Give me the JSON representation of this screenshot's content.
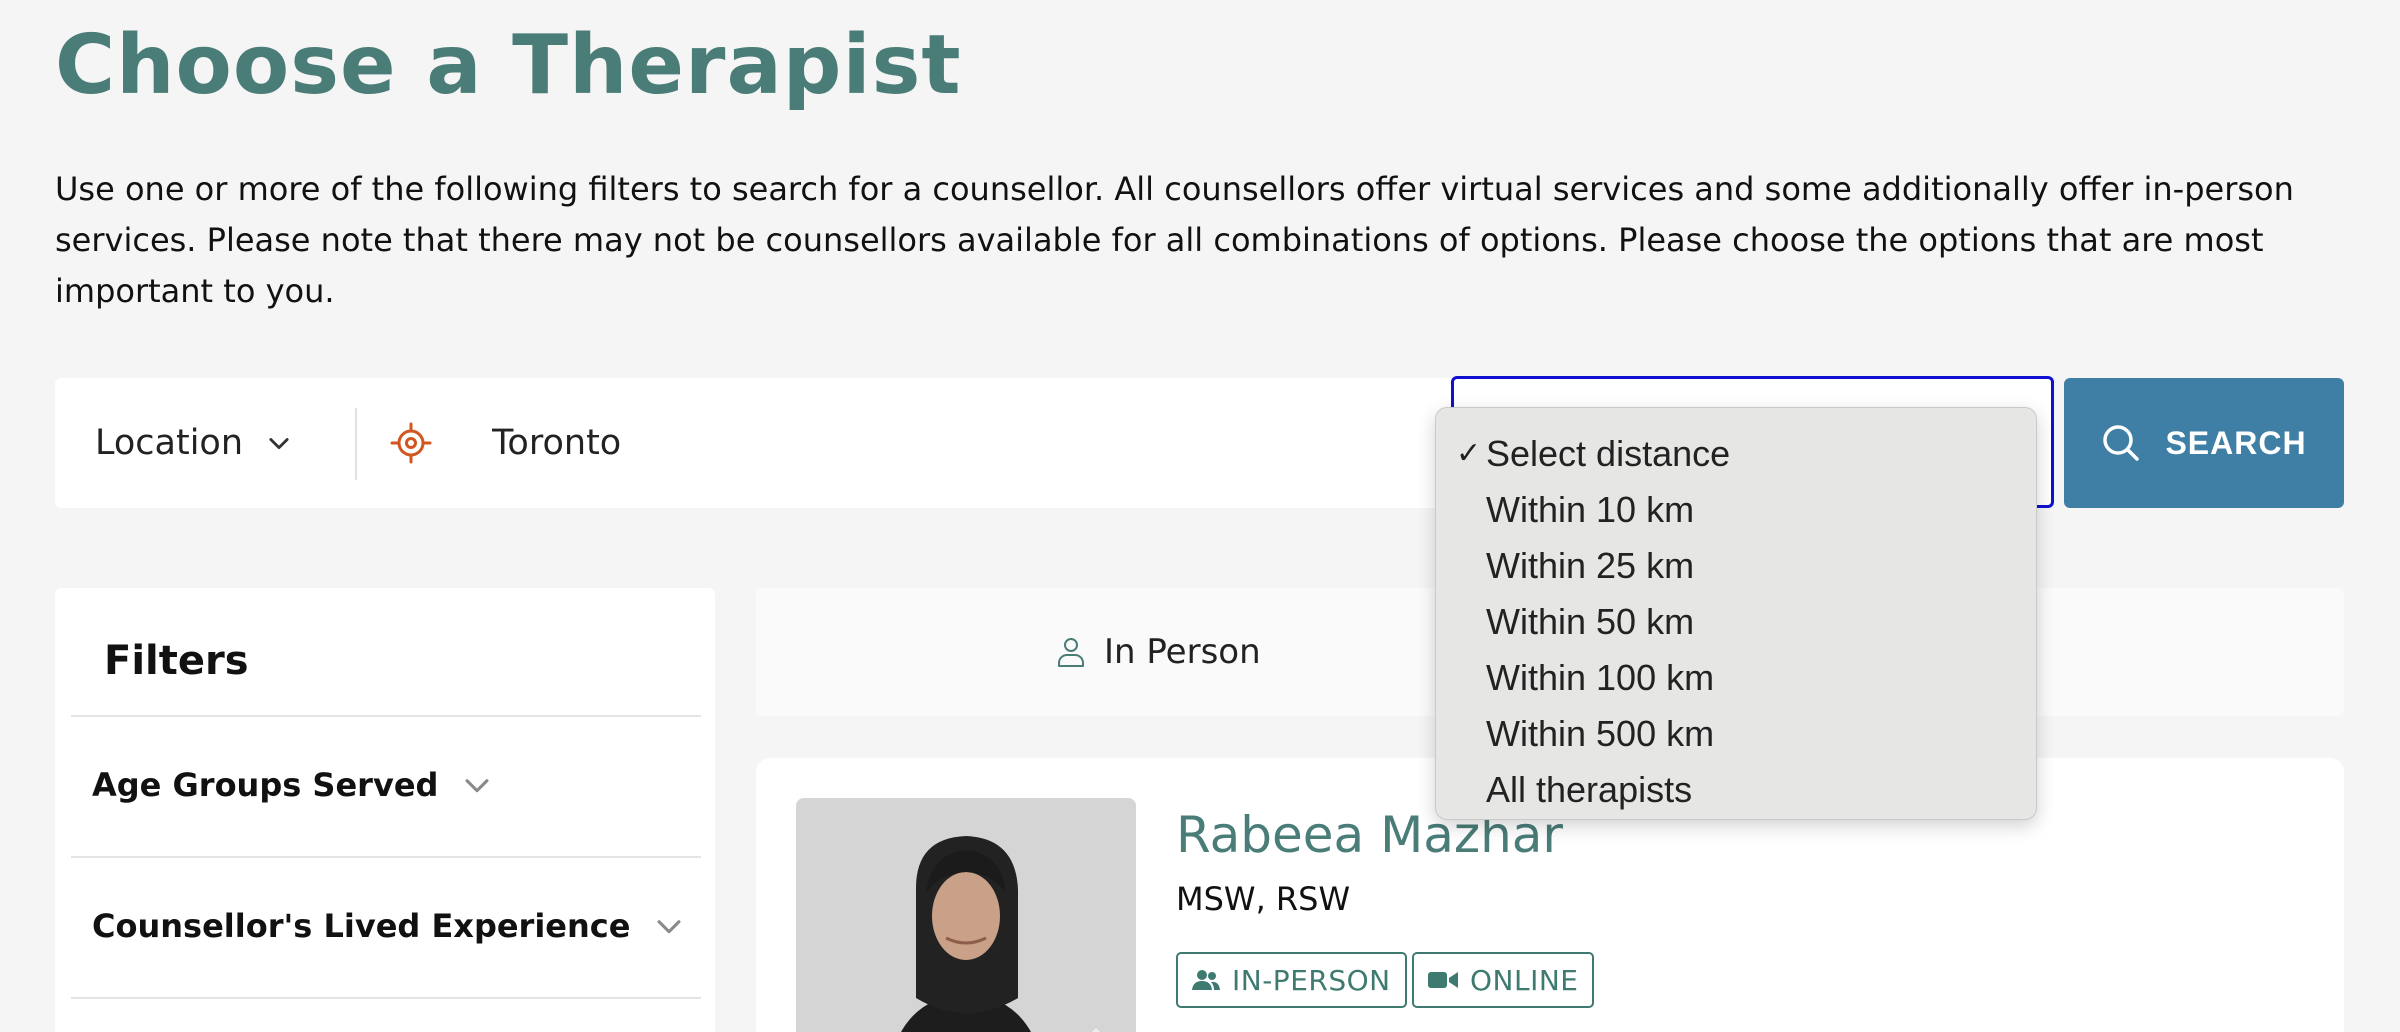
{
  "page": {
    "title": "Choose a Therapist",
    "intro": "Use one or more of the following filters to search for a counsellor. All counsellors offer virtual services and some additionally offer in-person services. Please note that there may not be counsellors available for all combinations of options. Please choose the options that are most important to you."
  },
  "search": {
    "location_label": "Location",
    "location_value": "Toronto",
    "button_label": "SEARCH",
    "distance_options": [
      {
        "label": "Select distance",
        "selected": true
      },
      {
        "label": "Within 10 km",
        "selected": false
      },
      {
        "label": "Within 25 km",
        "selected": false
      },
      {
        "label": "Within 50 km",
        "selected": false
      },
      {
        "label": "Within 100 km",
        "selected": false
      },
      {
        "label": "Within 500 km",
        "selected": false
      },
      {
        "label": "All therapists",
        "selected": false
      }
    ],
    "check_glyph": "✓"
  },
  "filters": {
    "title": "Filters",
    "items": [
      {
        "label": "Age Groups Served"
      },
      {
        "label": "Counsellor's Lived Experience"
      }
    ]
  },
  "tabs": {
    "in_person_label": "In Person"
  },
  "counsellor": {
    "name": "Rabeea Mazhar",
    "credentials": "MSW, RSW",
    "badges": [
      "IN-PERSON",
      "ONLINE"
    ]
  },
  "colors": {
    "title": "#4a7c78",
    "search_button": "#3f7fa6",
    "target_icon": "#d2561f",
    "focus_outline": "#1010d0"
  }
}
